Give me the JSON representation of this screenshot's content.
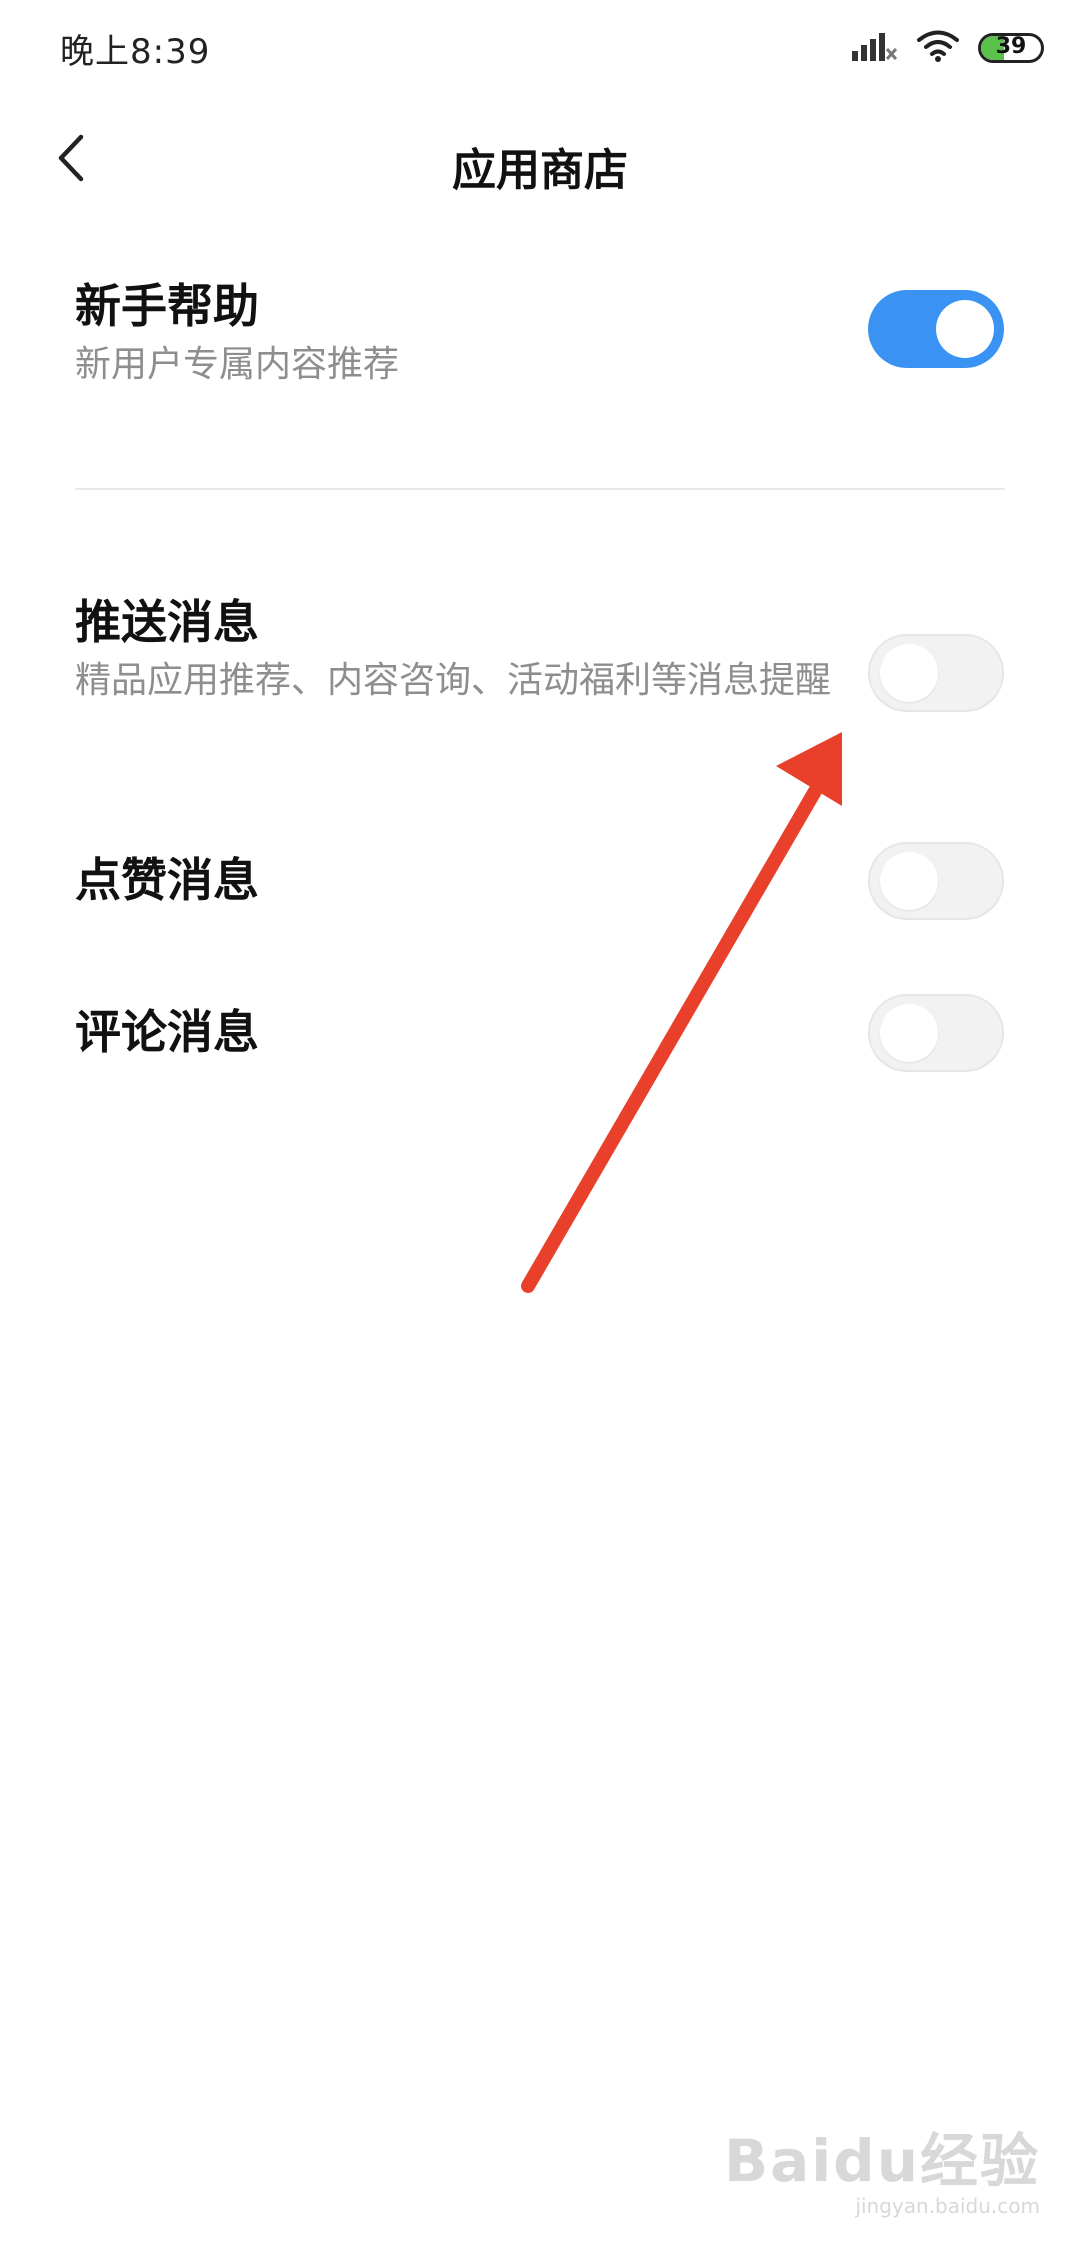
{
  "status_bar": {
    "time": "晚上8:39",
    "battery_level": "39",
    "battery_percent": 39,
    "icons": [
      "signal-icon",
      "wifi-icon",
      "battery-icon"
    ]
  },
  "header": {
    "title": "应用商店",
    "back_icon": "chevron-left-icon"
  },
  "settings": [
    {
      "title": "新手帮助",
      "description": "新用户专属内容推荐",
      "enabled": true
    },
    {
      "title": "推送消息",
      "description": "精品应用推荐、内容咨询、活动福利等消息提醒",
      "enabled": false
    },
    {
      "title": "点赞消息",
      "description": "",
      "enabled": false
    },
    {
      "title": "评论消息",
      "description": "",
      "enabled": false
    }
  ],
  "colors": {
    "switch_on": "#3a92f2",
    "switch_off": "#f2f2f2",
    "annotation_arrow": "#e8402a"
  },
  "watermark": {
    "logo": "Baidu经验",
    "url": "jingyan.baidu.com"
  }
}
